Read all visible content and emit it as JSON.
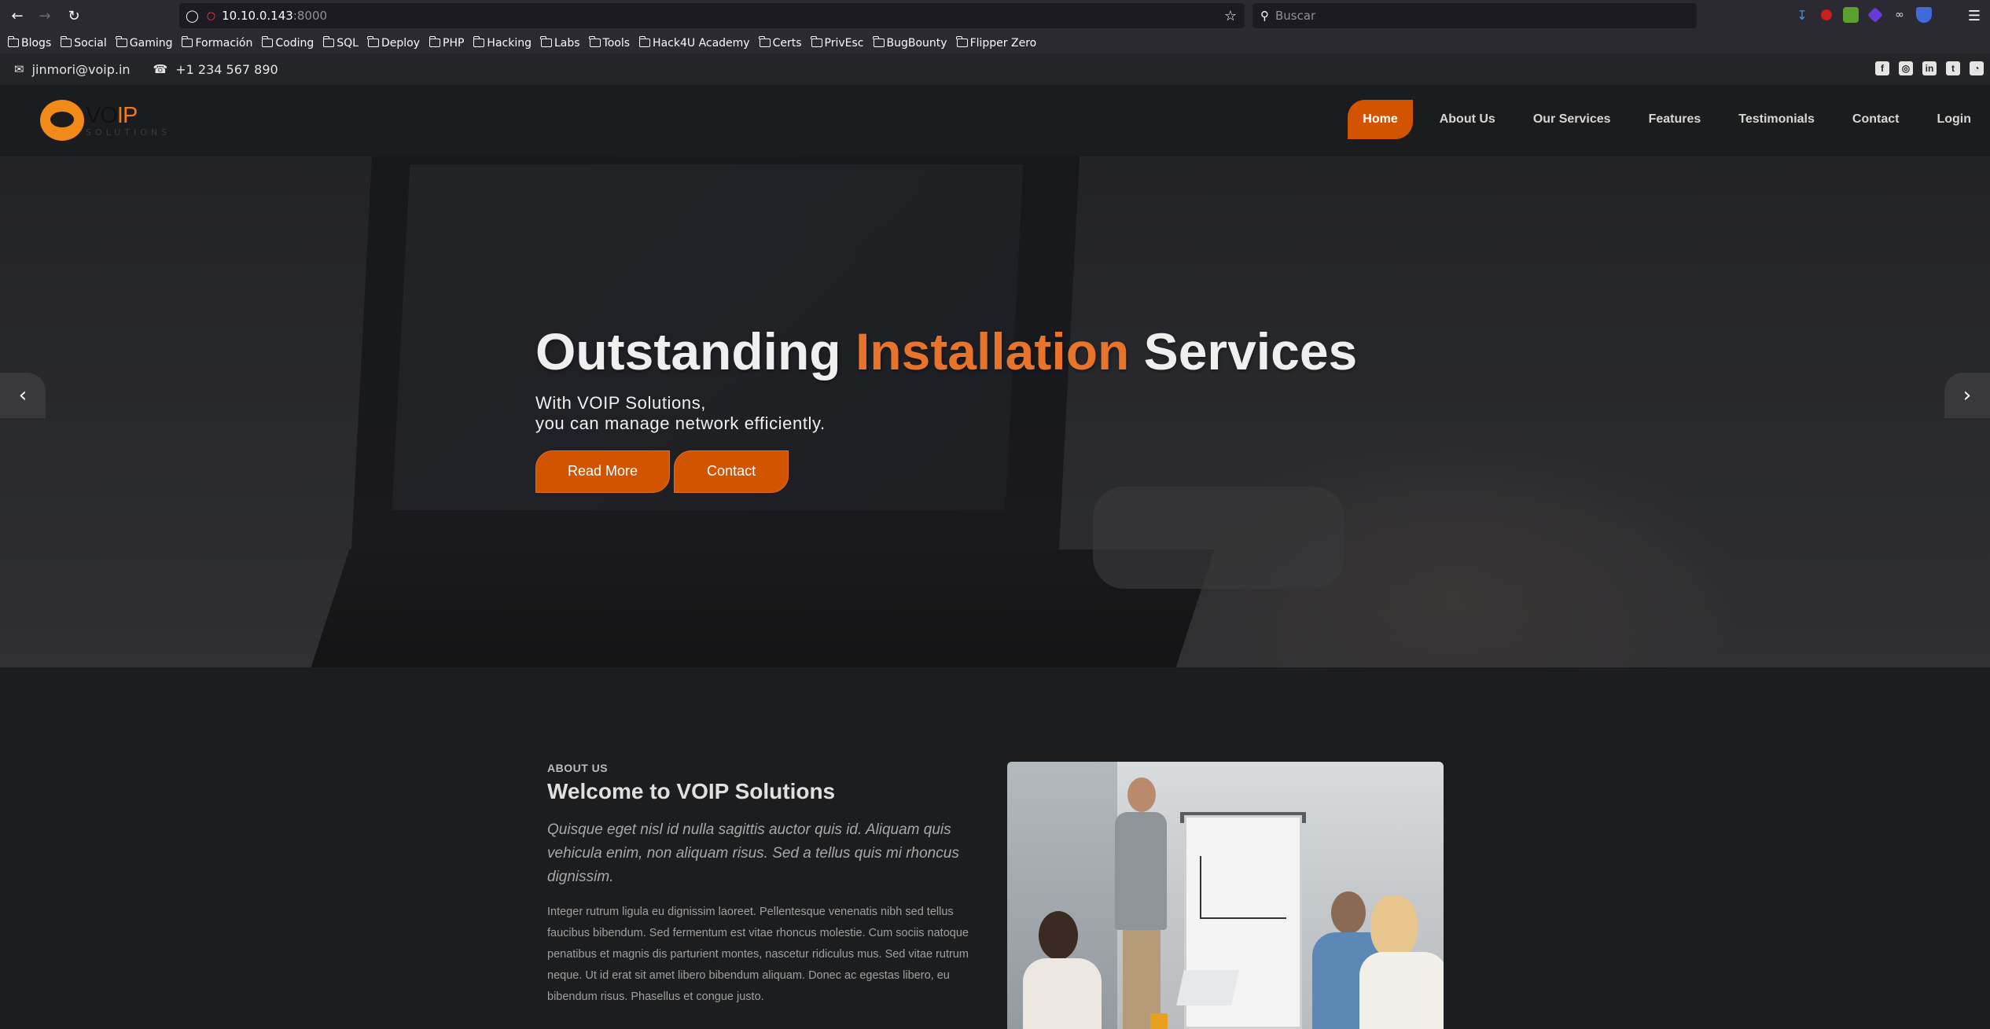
{
  "browser": {
    "url_host": "10.10.0.143",
    "url_port": ":8000",
    "search_placeholder": "Buscar",
    "bookmarks": [
      "Blogs",
      "Social",
      "Gaming",
      "Formación",
      "Coding",
      "SQL",
      "Deploy",
      "PHP",
      "Hacking",
      "Labs",
      "Tools",
      "Hack4U Academy",
      "Certs",
      "PrivEsc",
      "BugBounty",
      "Flipper Zero"
    ],
    "extension_colors": [
      "#4a90d9",
      "#c81e1e",
      "#5aa02c",
      "#6a3ad8",
      "#d8d8d8",
      "#3f6ad8"
    ]
  },
  "topbar": {
    "email": "jinmori@voip.in",
    "phone": "+1 234 567 890",
    "social": [
      {
        "name": "facebook-icon",
        "glyph": "f"
      },
      {
        "name": "instagram-icon",
        "glyph": "◎"
      },
      {
        "name": "linkedin-icon",
        "glyph": "in"
      },
      {
        "name": "twitter-icon",
        "glyph": "t"
      },
      {
        "name": "rss-icon",
        "glyph": "◔"
      }
    ]
  },
  "logo": {
    "vo": "VO",
    "ip": "IP",
    "sub": "SOLUTIONS"
  },
  "nav": {
    "items": [
      "Home",
      "About Us",
      "Our Services",
      "Features",
      "Testimonials",
      "Contact",
      "Login"
    ],
    "active_index": 0
  },
  "hero": {
    "title_part1": "Outstanding ",
    "title_accent": "Installation",
    "title_part2": " Services",
    "sub_line1": "With VOIP Solutions,",
    "sub_line2": "you can manage network efficiently.",
    "btn_read_more": "Read More",
    "btn_contact": "Contact"
  },
  "about": {
    "kicker": "ABOUT US",
    "title": "Welcome to VOIP Solutions",
    "lead": "Quisque eget nisl id nulla sagittis auctor quis id. Aliquam quis vehicula enim, non aliquam risus. Sed a tellus quis mi rhoncus dignissim.",
    "body": "Integer rutrum ligula eu dignissim laoreet. Pellentesque venenatis nibh sed tellus faucibus bibendum. Sed fermentum est vitae rhoncus molestie. Cum sociis natoque penatibus et magnis dis parturient montes, nascetur ridiculus mus. Sed vitae rutrum neque. Ut id erat sit amet libero bibendum aliquam. Donec ac egestas libero, eu bibendum risus. Phasellus et congue justo."
  },
  "colors": {
    "accent": "#d35400",
    "accent_text": "#e8732a"
  }
}
